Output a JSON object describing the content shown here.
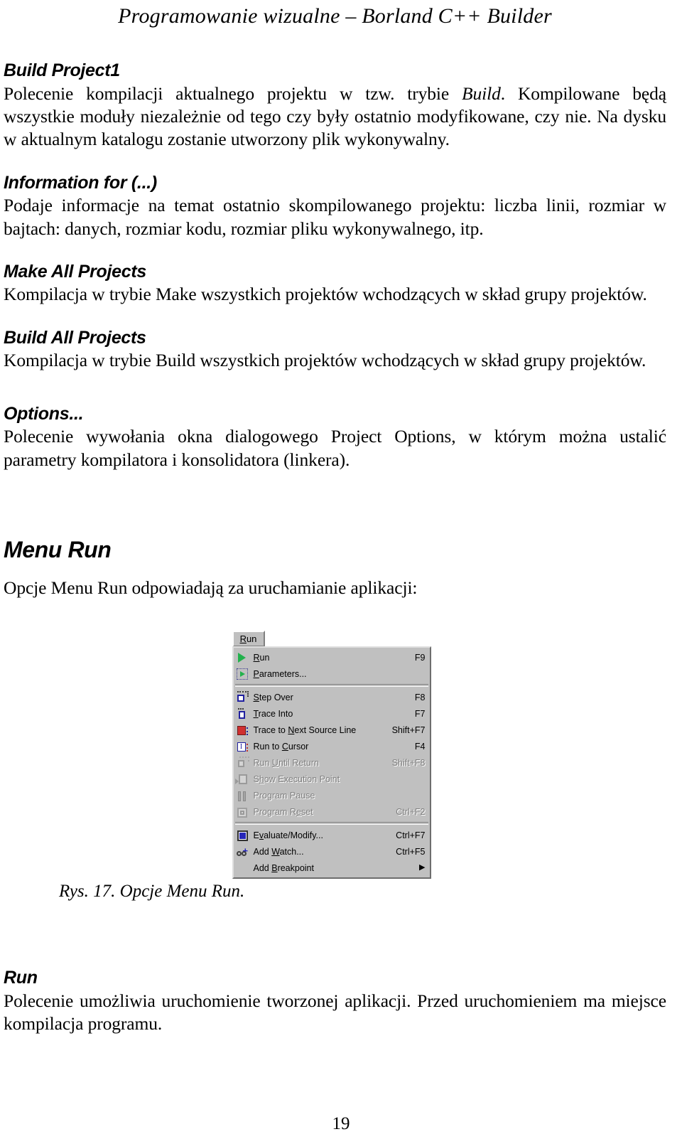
{
  "running_head": "Programowanie wizualne – Borland C++ Builder",
  "page_number": "19",
  "sections": [
    {
      "heading": "Build Project1",
      "body_before_em": "Polecenie kompilacji aktualnego projektu w tzw. trybie ",
      "body_em": "Build",
      "body_after_em": ". Kompilowane będą wszystkie moduły niezależnie od tego czy były ostatnio modyfikowane, czy nie. Na dysku w aktualnym katalogu zostanie utworzony plik wykonywalny."
    },
    {
      "heading": "Information for (...)",
      "body": "Podaje informacje na temat ostatnio skompilowanego projektu: liczba linii, rozmiar w bajtach: danych, rozmiar kodu, rozmiar pliku wykonywalnego, itp."
    },
    {
      "heading": "Make All Projects",
      "body": "Kompilacja w trybie Make wszystkich projektów wchodzących w skład grupy projektów."
    },
    {
      "heading": "Build All Projects",
      "body": "Kompilacja w trybie Build wszystkich projektów wchodzących w skład grupy projektów."
    },
    {
      "heading": "Options...",
      "body": "Polecenie wywołania okna dialogowego Project Options, w którym można ustalić parametry kompilatora i konsolidatora (linkera)."
    }
  ],
  "menu_run_section": {
    "heading": "Menu Run",
    "intro": "Opcje Menu Run odpowiadają za uruchamianie aplikacji:"
  },
  "figure": {
    "menubar_button": {
      "prefix": "R",
      "rest": "un"
    },
    "items": [
      {
        "icon": "run-triangle-icon",
        "pre": "R",
        "under": "",
        "post": "un",
        "label": "Run",
        "accel": "F9",
        "disabled": false,
        "submenu": false
      },
      {
        "icon": "parameters-icon",
        "pre": "",
        "under": "P",
        "post": "arameters...",
        "label": "Parameters...",
        "accel": "",
        "disabled": false,
        "submenu": false
      },
      {
        "separator": true
      },
      {
        "icon": "step-over-icon",
        "pre": "",
        "under": "S",
        "post": "tep Over",
        "label": "Step Over",
        "accel": "F8",
        "disabled": false,
        "submenu": false
      },
      {
        "icon": "trace-into-icon",
        "pre": "",
        "under": "T",
        "post": "race Into",
        "label": "Trace Into",
        "accel": "F7",
        "disabled": false,
        "submenu": false
      },
      {
        "icon": "trace-next-source-icon",
        "pre": "Trace to ",
        "under": "N",
        "post": "ext Source Line",
        "label": "Trace to Next Source Line",
        "accel": "Shift+F7",
        "disabled": false,
        "submenu": false
      },
      {
        "icon": "run-to-cursor-icon",
        "pre": "Run to ",
        "under": "C",
        "post": "ursor",
        "label": "Run to Cursor",
        "accel": "F4",
        "disabled": false,
        "submenu": false
      },
      {
        "icon": "run-until-return-icon",
        "pre": "Run ",
        "under": "U",
        "post": "ntil Return",
        "label": "Run Until Return",
        "accel": "Shift+F8",
        "disabled": true,
        "submenu": false
      },
      {
        "icon": "show-execution-point-icon",
        "pre": "S",
        "under": "h",
        "post": "ow Execution Point",
        "label": "Show Execution Point",
        "accel": "",
        "disabled": true,
        "submenu": false
      },
      {
        "icon": "program-pause-icon",
        "pre": "Program Pause",
        "under": "",
        "post": "",
        "label": "Program Pause",
        "accel": "",
        "disabled": true,
        "submenu": false
      },
      {
        "icon": "program-reset-icon",
        "pre": "Program R",
        "under": "e",
        "post": "set",
        "label": "Program Reset",
        "accel": "Ctrl+F2",
        "disabled": true,
        "submenu": false
      },
      {
        "separator": true
      },
      {
        "icon": "evaluate-modify-icon",
        "pre": "E",
        "under": "v",
        "post": "aluate/Modify...",
        "label": "Evaluate/Modify...",
        "accel": "Ctrl+F7",
        "disabled": false,
        "submenu": false
      },
      {
        "icon": "add-watch-icon",
        "pre": "Add ",
        "under": "W",
        "post": "atch...",
        "label": "Add Watch...",
        "accel": "Ctrl+F5",
        "disabled": false,
        "submenu": false
      },
      {
        "icon": "none",
        "pre": "Add ",
        "under": "B",
        "post": "reakpoint",
        "label": "Add Breakpoint",
        "accel": "",
        "disabled": false,
        "submenu": true,
        "submenu_glyph": "▶"
      }
    ],
    "caption": "Rys. 17. Opcje Menu Run."
  },
  "run_section": {
    "heading": "Run",
    "body": "Polecenie umożliwia uruchomienie tworzonej aplikacji. Przed uruchomieniem ma miejsce kompilacja programu."
  },
  "colors": {
    "menu_face": "#c0c0c0",
    "menu_shadow": "#808080",
    "menu_highlight": "#ffffff",
    "disabled_text": "#808080",
    "run_icon_green": "#22b14c"
  }
}
